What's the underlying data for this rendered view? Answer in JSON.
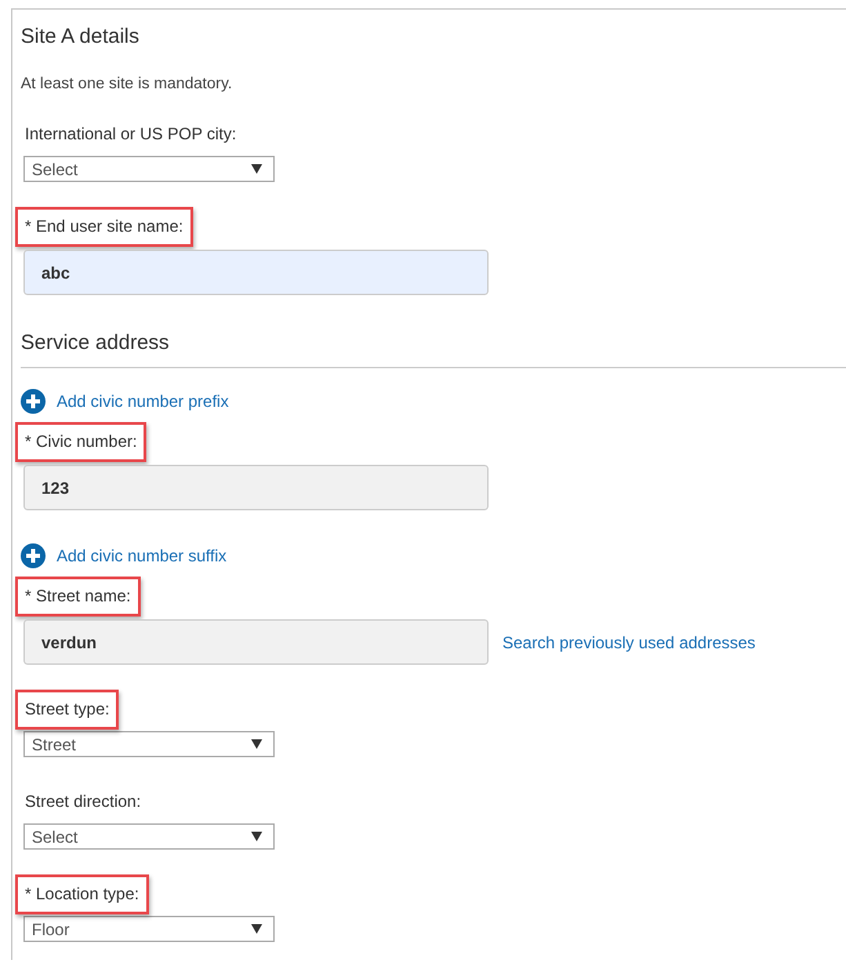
{
  "sections": [
    {
      "title": "Site A details",
      "heading_rule": false,
      "note": "At least one site is mandatory.",
      "items": [
        {
          "kind": "select",
          "label": "International or US POP city:",
          "highlighted": false,
          "value": "Select"
        },
        {
          "kind": "text",
          "label": "* End user site name:",
          "highlighted": true,
          "value": "abc",
          "autofilled": true
        }
      ]
    },
    {
      "title": "Service address",
      "heading_rule": true,
      "items": [
        {
          "kind": "add_link",
          "label": "Add civic number prefix"
        },
        {
          "kind": "text",
          "label": "* Civic number:",
          "highlighted": true,
          "value": "123",
          "autofilled": false
        },
        {
          "kind": "add_link",
          "label": "Add civic number suffix"
        },
        {
          "kind": "text",
          "label": "* Street name:",
          "highlighted": true,
          "value": "verdun",
          "autofilled": false,
          "side_link": "Search previously used addresses"
        },
        {
          "kind": "select",
          "label": "Street type:",
          "highlighted": true,
          "value": "Street"
        },
        {
          "kind": "select",
          "label": "Street direction:",
          "highlighted": false,
          "value": "Select"
        },
        {
          "kind": "select",
          "label": "* Location type:",
          "highlighted": true,
          "value": "Floor"
        }
      ]
    }
  ]
}
